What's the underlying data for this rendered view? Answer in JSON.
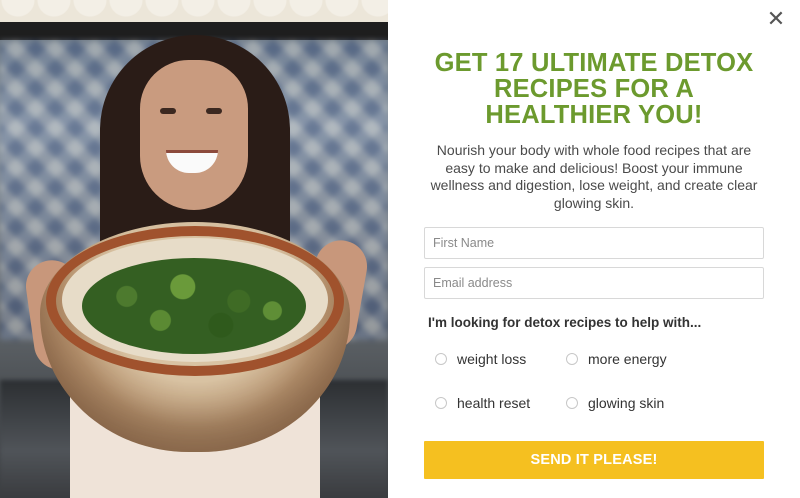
{
  "popup": {
    "headline": "GET 17 ULTIMATE DETOX RECIPES FOR A HEALTHIER YOU!",
    "description": "Nourish your body with whole food recipes that are easy to make and delicious! Boost your immune wellness and digestion, lose weight, and create clear glowing skin.",
    "close_icon": "close-icon",
    "close_glyph": "✕"
  },
  "form": {
    "first_name": {
      "placeholder": "First Name",
      "value": ""
    },
    "email": {
      "placeholder": "Email address",
      "value": ""
    },
    "question": "I'm looking for detox recipes to help with...",
    "options": [
      {
        "label": "weight loss",
        "selected": false
      },
      {
        "label": "more energy",
        "selected": false
      },
      {
        "label": "health reset",
        "selected": false
      },
      {
        "label": "glowing skin",
        "selected": false
      }
    ],
    "submit_label": "SEND IT PLEASE!"
  },
  "colors": {
    "headline": "#6c9a2e",
    "button": "#f5c020",
    "text": "#4a4a4a"
  }
}
